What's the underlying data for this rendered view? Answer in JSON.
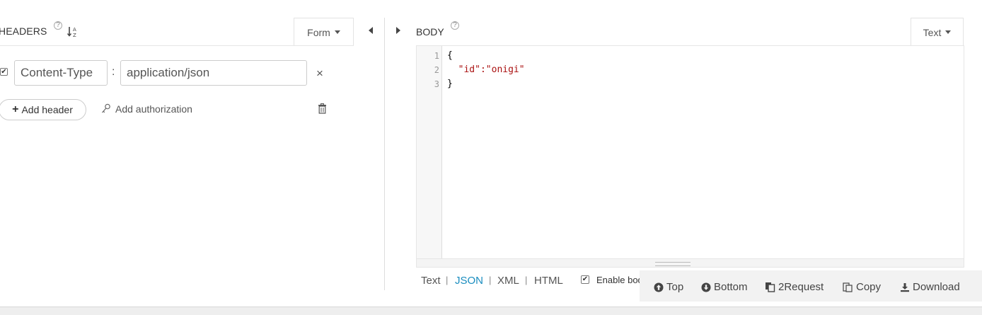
{
  "headers": {
    "title": "HEADERS",
    "help_glyph": "?",
    "sort_icon": "sort-alpha-icon",
    "mode_button": "Form",
    "rows": [
      {
        "enabled": true,
        "key": "Content-Type",
        "separator": ":",
        "value": "application/json",
        "remove_glyph": "×"
      }
    ],
    "add_header_label": "Add header",
    "add_header_glyph": "+",
    "add_authorization_label": "Add authorization"
  },
  "body": {
    "title": "BODY",
    "help_glyph": "?",
    "mode_button": "Text",
    "code_lines": [
      {
        "number": "1",
        "text": "{"
      },
      {
        "number": "2",
        "text": "  \"id\":\"onigi\""
      },
      {
        "number": "3",
        "text": "}"
      }
    ],
    "format_options": [
      "Text",
      "JSON",
      "XML",
      "HTML"
    ],
    "active_format": "JSON",
    "format_separator": "|",
    "enable_body_label": "Enable body",
    "enable_body_checked": true
  },
  "toolbar": {
    "top": "Top",
    "bottom": "Bottom",
    "to_request": "2Request",
    "copy": "Copy",
    "download": "Download"
  },
  "colors": {
    "accent": "#1a8dbf",
    "string": "#aa1111",
    "toolbar_bg": "#f2f2f2"
  }
}
